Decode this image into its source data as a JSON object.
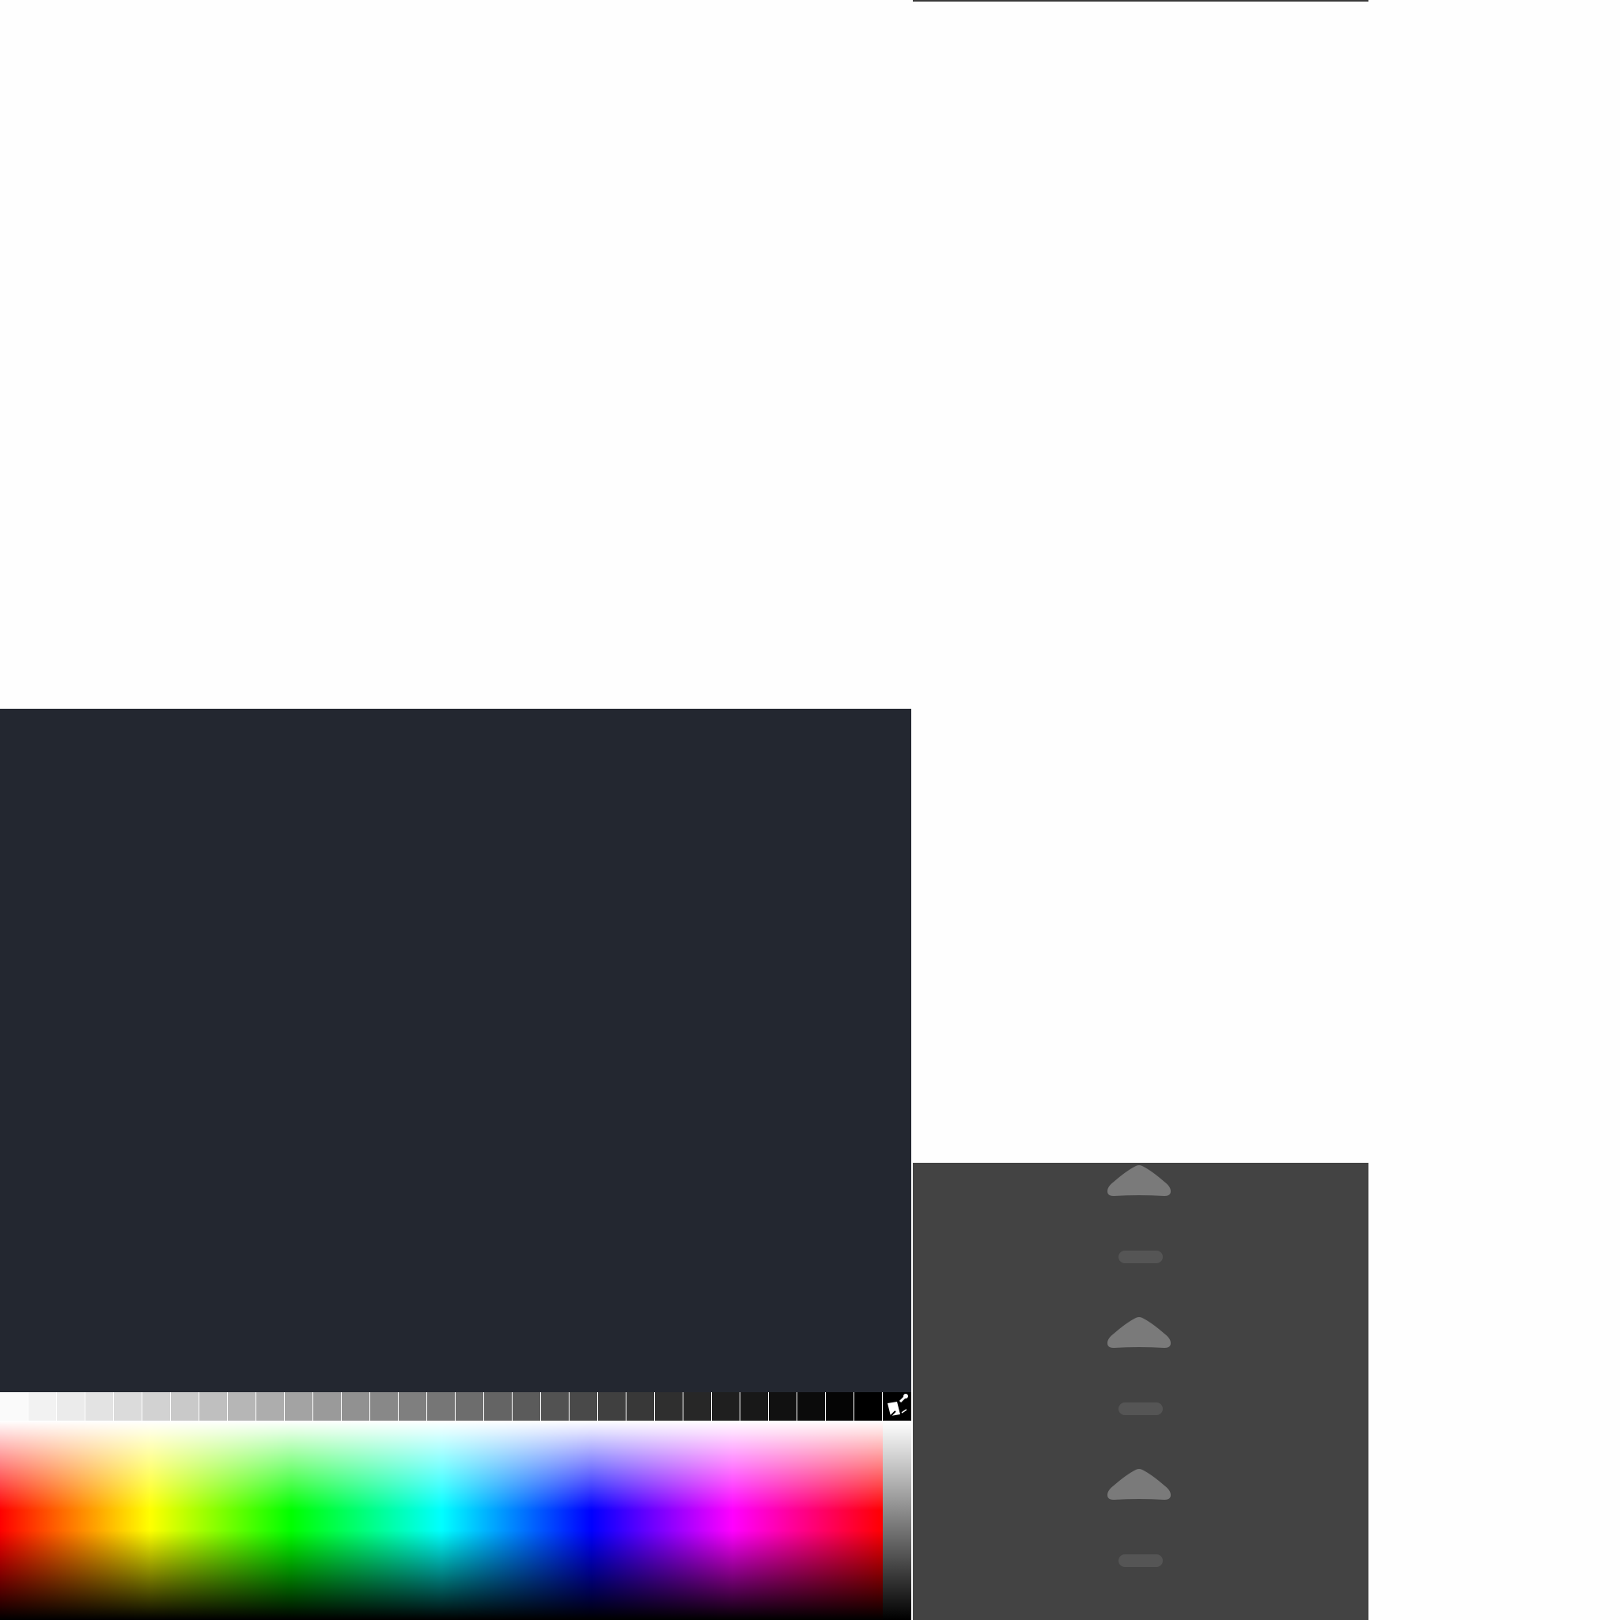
{
  "colors": {
    "page_bg": "#fefefe",
    "dark_panel": "#232730",
    "right_panel": "#434343",
    "chevron": "#7a7a7a",
    "dash": "#555555"
  },
  "swatches": [
    "#fafafa",
    "#f2f2f2",
    "#ebebeb",
    "#e3e3e3",
    "#dbdbdb",
    "#d2d2d2",
    "#c9c9c9",
    "#bfbfbf",
    "#b6b6b6",
    "#adadad",
    "#a3a3a3",
    "#9a9a9a",
    "#919191",
    "#888888",
    "#7f7f7f",
    "#767676",
    "#6d6d6d",
    "#646464",
    "#5b5b5b",
    "#525252",
    "#494949",
    "#404040",
    "#383838",
    "#2f2f2f",
    "#272727",
    "#1f1f1f",
    "#181818",
    "#111111",
    "#0b0b0b",
    "#050505",
    "#000000"
  ],
  "icons": {
    "picker": "color-picker-icon",
    "chevron": "chevron-up-icon",
    "dash": "dash-icon"
  }
}
